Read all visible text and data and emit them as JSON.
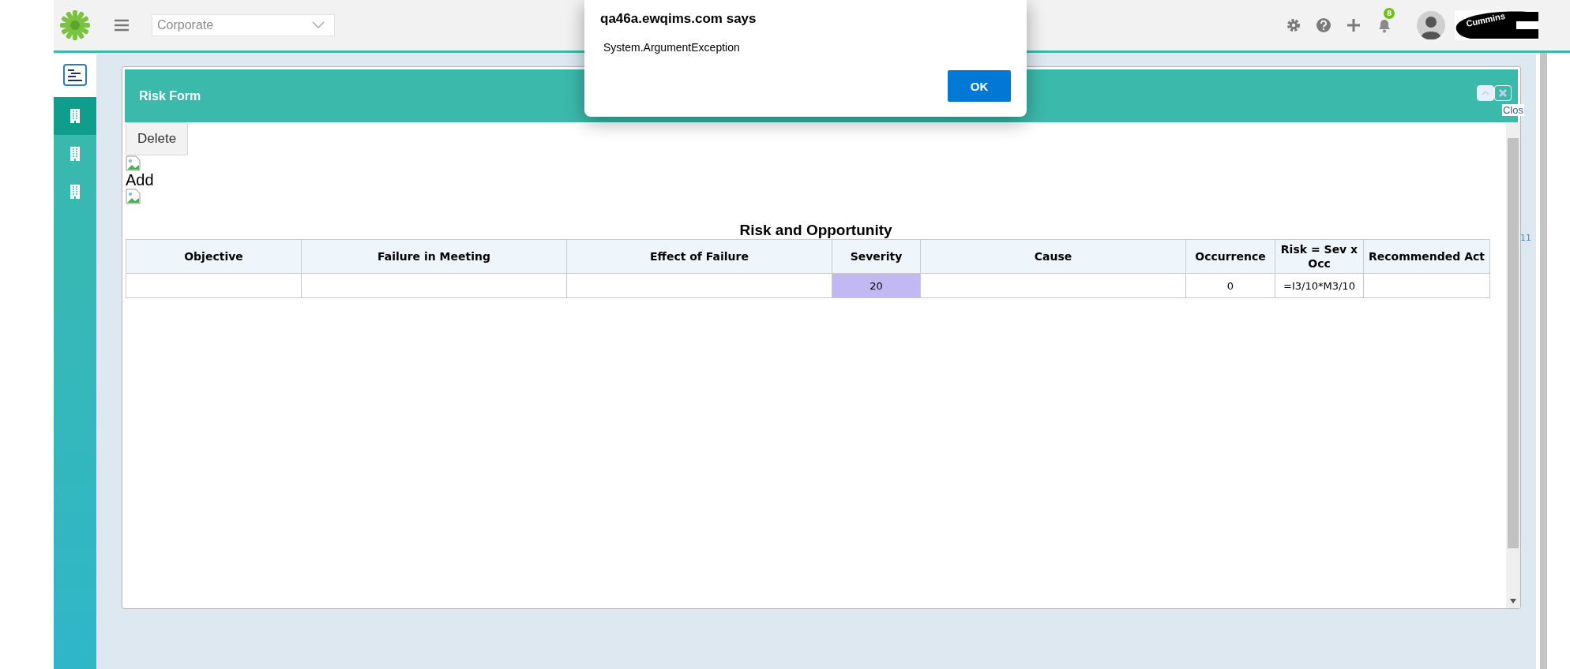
{
  "top_bar": {
    "org_select": {
      "value": "Corporate"
    },
    "notification_count": "8",
    "company_logo_text": "Cummins"
  },
  "sidebar": {
    "items": [
      {
        "kind": "document",
        "selected": false
      },
      {
        "kind": "building",
        "selected": true
      },
      {
        "kind": "building",
        "selected": false
      },
      {
        "kind": "building",
        "selected": false
      }
    ]
  },
  "background_text": "11",
  "modal": {
    "title": "Risk Form",
    "close_label": "Clos",
    "delete_button": "Delete",
    "add_label": "Add",
    "table": {
      "title": "Risk and Opportunity",
      "columns": [
        "Objective",
        "Failure in Meeting",
        "Effect of Failure",
        "Severity",
        "Cause",
        "Occurrence",
        "Risk = Sev x Occ",
        "Recommended Act"
      ],
      "rows": [
        [
          {
            "highlighted": false
          },
          {
            "highlighted": false
          },
          {
            "highlighted": false
          },
          {
            "text": "20",
            "highlighted": true
          },
          {
            "highlighted": false
          },
          {
            "text": "0",
            "highlighted": false
          },
          {
            "text": "=I3/10*M3/10",
            "highlighted": false
          },
          {
            "highlighted": false
          }
        ]
      ]
    }
  },
  "alert": {
    "title": "qa46a.ewqims.com says",
    "message": "System.ArgumentException",
    "ok_button": "OK"
  }
}
